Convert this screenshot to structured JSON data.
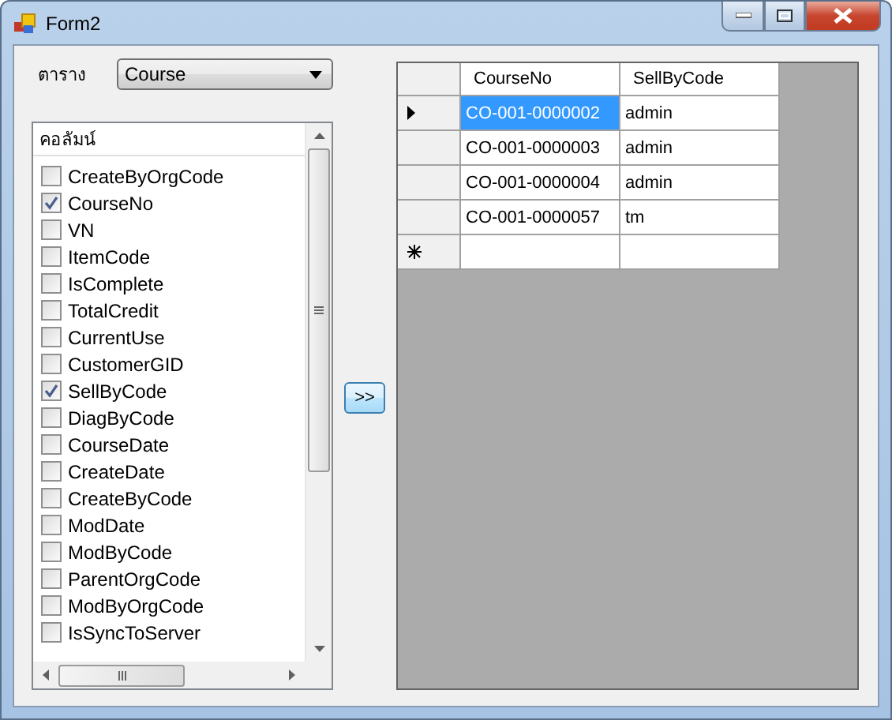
{
  "window": {
    "title": "Form2"
  },
  "table_label": "ตาราง",
  "table_select": {
    "value": "Course"
  },
  "columns_list": {
    "header": "คอลัมน์",
    "items": [
      {
        "label": "CreateByOrgCode",
        "checked": false
      },
      {
        "label": "CourseNo",
        "checked": true
      },
      {
        "label": "VN",
        "checked": false
      },
      {
        "label": "ItemCode",
        "checked": false
      },
      {
        "label": "IsComplete",
        "checked": false
      },
      {
        "label": "TotalCredit",
        "checked": false
      },
      {
        "label": "CurrentUse",
        "checked": false
      },
      {
        "label": "CustomerGID",
        "checked": false
      },
      {
        "label": "SellByCode",
        "checked": true
      },
      {
        "label": "DiagByCode",
        "checked": false
      },
      {
        "label": "CourseDate",
        "checked": false
      },
      {
        "label": "CreateDate",
        "checked": false
      },
      {
        "label": "CreateByCode",
        "checked": false
      },
      {
        "label": "ModDate",
        "checked": false
      },
      {
        "label": "ModByCode",
        "checked": false
      },
      {
        "label": "ParentOrgCode",
        "checked": false
      },
      {
        "label": "ModByOrgCode",
        "checked": false
      },
      {
        "label": "IsSyncToServer",
        "checked": false
      }
    ]
  },
  "add_button": ">>",
  "grid": {
    "columns": [
      "CourseNo",
      "SellByCode"
    ],
    "rows": [
      {
        "kind": "data",
        "current": true,
        "cells": [
          {
            "text": "CO-001-0000002",
            "selected": true
          },
          {
            "text": "admin",
            "selected": false
          }
        ]
      },
      {
        "kind": "data",
        "current": false,
        "cells": [
          {
            "text": "CO-001-0000003",
            "selected": false
          },
          {
            "text": "admin",
            "selected": false
          }
        ]
      },
      {
        "kind": "data",
        "current": false,
        "cells": [
          {
            "text": "CO-001-0000004",
            "selected": false
          },
          {
            "text": "admin",
            "selected": false
          }
        ]
      },
      {
        "kind": "data",
        "current": false,
        "cells": [
          {
            "text": "CO-001-0000057",
            "selected": false
          },
          {
            "text": "tm",
            "selected": false
          }
        ]
      },
      {
        "kind": "new",
        "current": false,
        "cells": []
      }
    ]
  }
}
